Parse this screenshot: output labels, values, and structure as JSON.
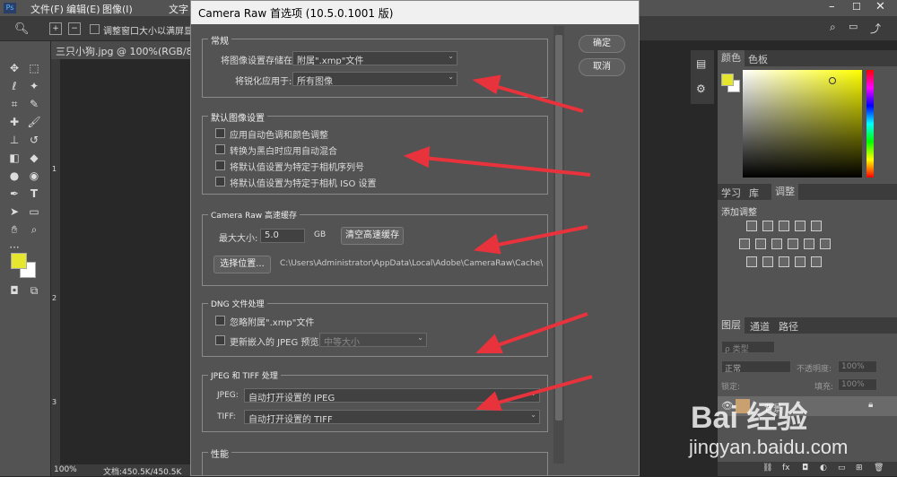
{
  "menubar": {
    "items": [
      "文件(F)",
      "编辑(E)",
      "图像(I)",
      "文字"
    ],
    "right_icons": [
      "minimize-icon",
      "maximize-icon",
      "close-icon"
    ]
  },
  "optbar": {
    "checkbox_label": "调整窗口大小以满屏显示"
  },
  "doc": {
    "tab_title": "三只小狗.jpg @ 100%(RGB/8#)",
    "zoom": "100%",
    "status": "文档:450.5K/450.5K",
    "ruler": [
      "1",
      "2",
      "3"
    ]
  },
  "dialog": {
    "title": "Camera Raw 首选项 (10.5.0.1001 版)",
    "ok": "确定",
    "cancel": "取消",
    "general": {
      "title": "常规",
      "save_label": "将图像设置存储在:",
      "save_value": "附属\".xmp\"文件",
      "sharpen_label": "将锐化应用于:",
      "sharpen_value": "所有图像"
    },
    "defaults": {
      "title": "默认图像设置",
      "items": [
        "应用自动色调和颜色调整",
        "转换为黑白时应用自动混合",
        "将默认值设置为特定于相机序列号",
        "将默认值设置为特定于相机 ISO 设置"
      ]
    },
    "cache": {
      "title": "Camera Raw 高速缓存",
      "max_label": "最大大小:",
      "max_value": "5.0",
      "unit": "GB",
      "purge": "清空高速缓存",
      "select": "选择位置...",
      "path": "C:\\Users\\Administrator\\AppData\\Local\\Adobe\\CameraRaw\\Cache\\"
    },
    "dng": {
      "title": "DNG 文件处理",
      "ignore": "忽略附属\".xmp\"文件",
      "update": "更新嵌入的 JPEG 预览:",
      "preview_value": "中等大小"
    },
    "jpegtiff": {
      "title": "JPEG 和 TIFF 处理",
      "jpeg_label": "JPEG:",
      "jpeg_value": "自动打开设置的 JPEG",
      "tiff_label": "TIFF:",
      "tiff_value": "自动打开设置的 TIFF"
    },
    "perf": {
      "title": "性能"
    }
  },
  "panels": {
    "color_tabs": [
      "颜色",
      "色板"
    ],
    "adj_tabs": [
      "学习",
      "库",
      "调整"
    ],
    "adj_title": "添加调整",
    "layer_tabs": [
      "图层",
      "通道",
      "路径"
    ],
    "kind": "ρ 类型",
    "blend": "正常",
    "opacity_label": "不透明度:",
    "opacity": "100%",
    "lock_label": "锁定:",
    "fill_label": "填充:",
    "fill": "100%",
    "layer_name": "背景"
  },
  "watermark": {
    "line1": "Bai 经验",
    "line2": "jingyan.baidu.com"
  },
  "colors": {
    "accent_arrow": "#e8323c",
    "fg_swatch": "#e6e62e"
  }
}
